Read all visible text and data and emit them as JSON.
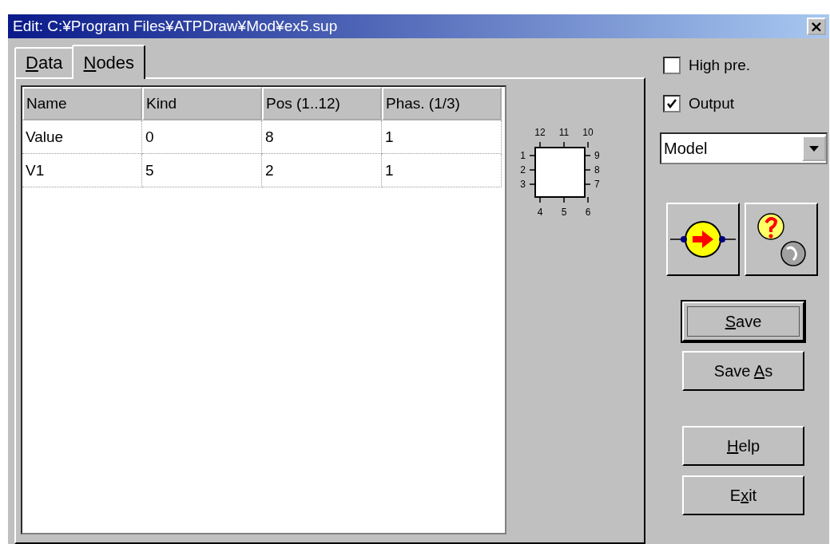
{
  "window": {
    "title": "Edit: C:¥Program Files¥ATPDraw¥Mod¥ex5.sup",
    "close": "×"
  },
  "tabs": [
    {
      "key": "D",
      "post": "ata",
      "selected": false
    },
    {
      "key": "N",
      "post": "odes",
      "selected": true
    }
  ],
  "table": {
    "columns": [
      "Name",
      "Kind",
      "Pos (1..12)",
      "Phas. (1/3)"
    ],
    "rows": [
      [
        "Value",
        "0",
        "8",
        "1"
      ],
      [
        "V1",
        "5",
        "2",
        "1"
      ]
    ]
  },
  "node_labels": [
    "12",
    "11",
    "10",
    "1",
    "9",
    "2",
    "8",
    "3",
    "7",
    "4",
    "5",
    "6"
  ],
  "checkboxes": [
    {
      "label": "High pre.",
      "checked": false
    },
    {
      "label": "Output",
      "checked": true
    }
  ],
  "dropdown": {
    "value": "Model"
  },
  "buttons": [
    {
      "key": "S",
      "post": "ave",
      "default": true
    },
    {
      "pre": "Save ",
      "key": "A",
      "post": "s",
      "default": false
    },
    {
      "key": "H",
      "post": "elp",
      "default": false
    },
    {
      "pre": "E",
      "key": "x",
      "post": "it",
      "default": false
    }
  ]
}
